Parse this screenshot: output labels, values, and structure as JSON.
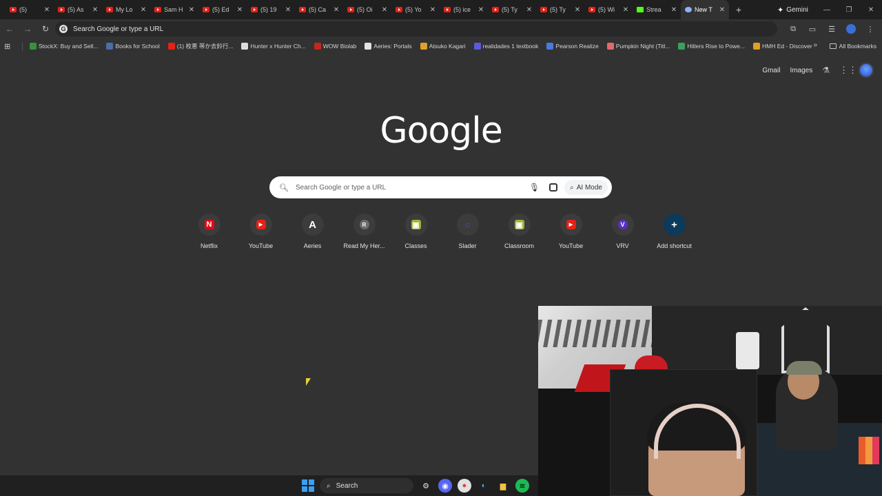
{
  "browser": {
    "tabs": [
      {
        "title": "(5)",
        "type": "youtube"
      },
      {
        "title": "(5) As",
        "type": "youtube"
      },
      {
        "title": "My Lo",
        "type": "youtube"
      },
      {
        "title": "Sam H",
        "type": "youtube"
      },
      {
        "title": "(5) Ed",
        "type": "youtube"
      },
      {
        "title": "(5) 19",
        "type": "youtube"
      },
      {
        "title": "(5) Ca",
        "type": "youtube"
      },
      {
        "title": "(5) Oi",
        "type": "youtube"
      },
      {
        "title": "(5) Yo",
        "type": "youtube"
      },
      {
        "title": "(5) ice",
        "type": "youtube"
      },
      {
        "title": "(5) Ty",
        "type": "youtube"
      },
      {
        "title": "(5) Ty",
        "type": "youtube"
      },
      {
        "title": "(5) Wi",
        "type": "youtube"
      },
      {
        "title": "Strea",
        "type": "kick"
      },
      {
        "title": "New T",
        "type": "newtab",
        "active": true
      }
    ],
    "gemini_label": "Gemini",
    "omnibox_text": "Search Google or type a URL",
    "bookmarks": [
      {
        "label": "StockX: Buy and Sell...",
        "color": "#3a8f3a"
      },
      {
        "label": "Books for School",
        "color": "#4a6ea8"
      },
      {
        "label": "(1) 枚悪 帯か去鈴行...",
        "color": "#e62117"
      },
      {
        "label": "Hunter x Hunter Ch...",
        "color": "#dcdcdc"
      },
      {
        "label": "WOW Biolab",
        "color": "#c3281e"
      },
      {
        "label": "Aeries: Portals",
        "color": "#e3e3e3"
      },
      {
        "label": "Atsuko Kagari",
        "color": "#e0a030"
      },
      {
        "label": "realidades 1 textbook",
        "color": "#5a5ae0"
      },
      {
        "label": "Pearson Realize",
        "color": "#4a7ae0"
      },
      {
        "label": "Pumpkin Night (Titl...",
        "color": "#e06a6a"
      },
      {
        "label": "Hitlers Rise to Powe...",
        "color": "#3aa05a"
      },
      {
        "label": "HMH Ed - Discover",
        "color": "#e0a020"
      }
    ],
    "all_bookmarks_label": "All Bookmarks"
  },
  "page": {
    "top_links": {
      "gmail": "Gmail",
      "images": "Images"
    },
    "logo_text": "Google",
    "search_placeholder": "Search Google or type a URL",
    "ai_mode_label": "AI Mode",
    "shortcuts": [
      {
        "label": "Netflix",
        "glyph": "N",
        "color": "#e50914"
      },
      {
        "label": "YouTube",
        "glyph": "▶",
        "color": "#e62117"
      },
      {
        "label": "Aeries",
        "glyph": "A",
        "color": "#3c3c3c"
      },
      {
        "label": "Read My Her...",
        "glyph": "R",
        "color": "#6b6b6b"
      },
      {
        "label": "Classes",
        "glyph": "▣",
        "color": "#9bb534"
      },
      {
        "label": "Slader",
        "glyph": "○",
        "color": "#5a4ae0"
      },
      {
        "label": "Classroom",
        "glyph": "▣",
        "color": "#9bb534"
      },
      {
        "label": "YouTube",
        "glyph": "▶",
        "color": "#e62117"
      },
      {
        "label": "VRV",
        "glyph": "V",
        "color": "#5a30c0"
      },
      {
        "label": "Add shortcut",
        "glyph": "+",
        "color": "#0b3a5a"
      }
    ]
  },
  "taskbar": {
    "search_label": "Search"
  }
}
